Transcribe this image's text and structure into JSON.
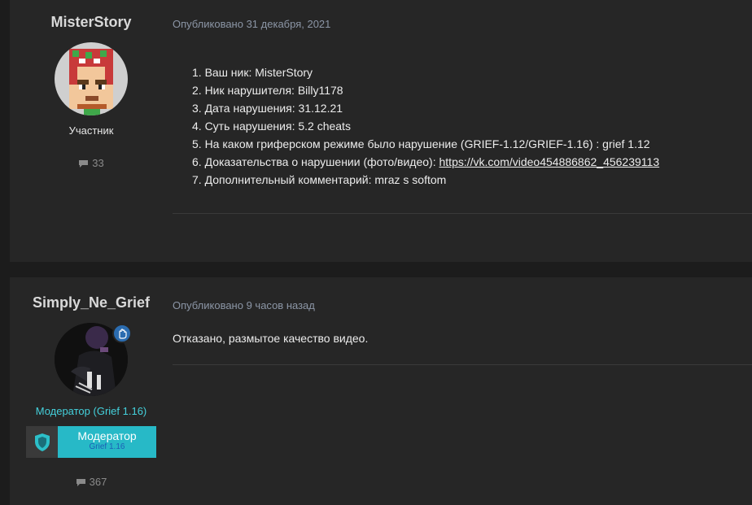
{
  "posts": [
    {
      "author": "MisterStory",
      "role": "Участник",
      "post_count": "33",
      "published": "Опубликовано 31 декабря, 2021",
      "items": [
        {
          "text": "1. Ваш ник: MisterStory"
        },
        {
          "text": "2. Ник нарушителя: Billy1178"
        },
        {
          "text": "3. Дата нарушения: 31.12.21"
        },
        {
          "text": "4. Суть нарушения: 5.2 cheats"
        },
        {
          "text": "5. На каком гриферском режиме было нарушение (GRIEF-1.12/GRIEF-1.16) : grief 1.12"
        },
        {
          "text": "6. Доказательства о нарушении (фото/видео): ",
          "link": "https://vk.com/video454886862_456239113"
        },
        {
          "text": "7. Дополнительный комментарий: mraz s softom"
        }
      ]
    },
    {
      "author": "Simply_Ne_Grief",
      "role": "Модератор (Grief 1.16)",
      "badge_main": "Модератор",
      "badge_sub": "Grief 1.16",
      "post_count": "367",
      "published": "Опубликовано 9 часов назад",
      "text": "Отказано, размытое качество видео."
    }
  ],
  "colors": {
    "accent_cyan": "#27b9c7",
    "role_mod": "#44d1dc",
    "meta": "#8c96a6"
  },
  "icons": {
    "comment": "comment-bubble-icon",
    "shield": "shield-icon",
    "online": "hand-icon"
  }
}
